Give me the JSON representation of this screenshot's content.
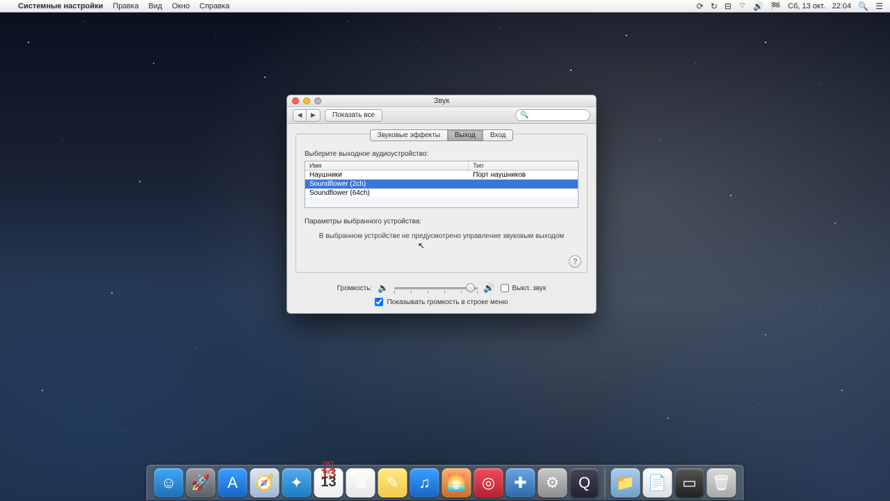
{
  "menubar": {
    "app_name": "Системные настройки",
    "items": [
      "Правка",
      "Вид",
      "Окно",
      "Справка"
    ],
    "status": {
      "date": "Сб, 13 окт.",
      "time": "22:04"
    }
  },
  "window": {
    "title": "Звук",
    "show_all": "Показать все",
    "search_placeholder": ""
  },
  "tabs": {
    "items": [
      {
        "label": "Звуковые эффекты",
        "active": false
      },
      {
        "label": "Выход",
        "active": true
      },
      {
        "label": "Вход",
        "active": false
      }
    ]
  },
  "output": {
    "heading": "Выберите выходное аудиоустройство:",
    "columns": {
      "name": "Имя",
      "type": "Тип"
    },
    "devices": [
      {
        "name": "Наушники",
        "type": "Порт наушников",
        "selected": false
      },
      {
        "name": "Soundflower (2ch)",
        "type": "",
        "selected": true
      },
      {
        "name": "Soundflower (64ch)",
        "type": "",
        "selected": false
      }
    ],
    "params_label": "Параметры выбранного устройства:",
    "message": "В выбранном устройстве не предусмотрено управление звуковым выходом"
  },
  "volume": {
    "label": "Громкость:",
    "value_percent": 96,
    "mute_label": "Выкл. звук",
    "mute_checked": false,
    "show_in_menubar_label": "Показывать громкость в строке меню",
    "show_in_menubar_checked": true
  },
  "dock": [
    {
      "name": "finder",
      "glyph": "☺",
      "bg": "linear-gradient(#3fa9f5,#1e6fb8)"
    },
    {
      "name": "launchpad",
      "glyph": "🚀",
      "bg": "linear-gradient(#9aa0a6,#5a5f66)"
    },
    {
      "name": "appstore",
      "glyph": "A",
      "bg": "linear-gradient(#3aa0ff,#1765c2)"
    },
    {
      "name": "safari",
      "glyph": "🧭",
      "bg": "linear-gradient(#dbe7f4,#9cb6d4)"
    },
    {
      "name": "twitter",
      "glyph": "✦",
      "bg": "linear-gradient(#55acee,#1b7bc2)"
    },
    {
      "name": "calendar",
      "glyph": "13",
      "bg": "linear-gradient(#fff,#eee)"
    },
    {
      "name": "reminders",
      "glyph": "≣",
      "bg": "linear-gradient(#fff,#e5e5e5)"
    },
    {
      "name": "notes",
      "glyph": "✎",
      "bg": "linear-gradient(#ffe97f,#f3c94b)"
    },
    {
      "name": "itunes",
      "glyph": "♫",
      "bg": "linear-gradient(#3aa0ff,#1765c2)"
    },
    {
      "name": "iphoto",
      "glyph": "🌅",
      "bg": "linear-gradient(#f7b267,#d06a2b)"
    },
    {
      "name": "photobooth",
      "glyph": "◎",
      "bg": "linear-gradient(#f04e5b,#b82030)"
    },
    {
      "name": "utilities",
      "glyph": "✚",
      "bg": "linear-gradient(#6aa5e6,#2d68a8)"
    },
    {
      "name": "systemprefs",
      "glyph": "⚙",
      "bg": "linear-gradient(#c9c9c9,#8b8b8b)"
    },
    {
      "name": "quicktime",
      "glyph": "Q",
      "bg": "linear-gradient(#445,#223)"
    }
  ],
  "dock_right": [
    {
      "name": "folder",
      "glyph": "📁",
      "bg": "linear-gradient(#a9cdeb,#6ea1cc)"
    },
    {
      "name": "document",
      "glyph": "📄",
      "bg": "linear-gradient(#fff,#ddd)"
    },
    {
      "name": "device",
      "glyph": "▭",
      "bg": "linear-gradient(#555,#222)"
    },
    {
      "name": "trash",
      "glyph": "🗑",
      "bg": "linear-gradient(#d8d8d8,#a8a8a8)"
    }
  ]
}
